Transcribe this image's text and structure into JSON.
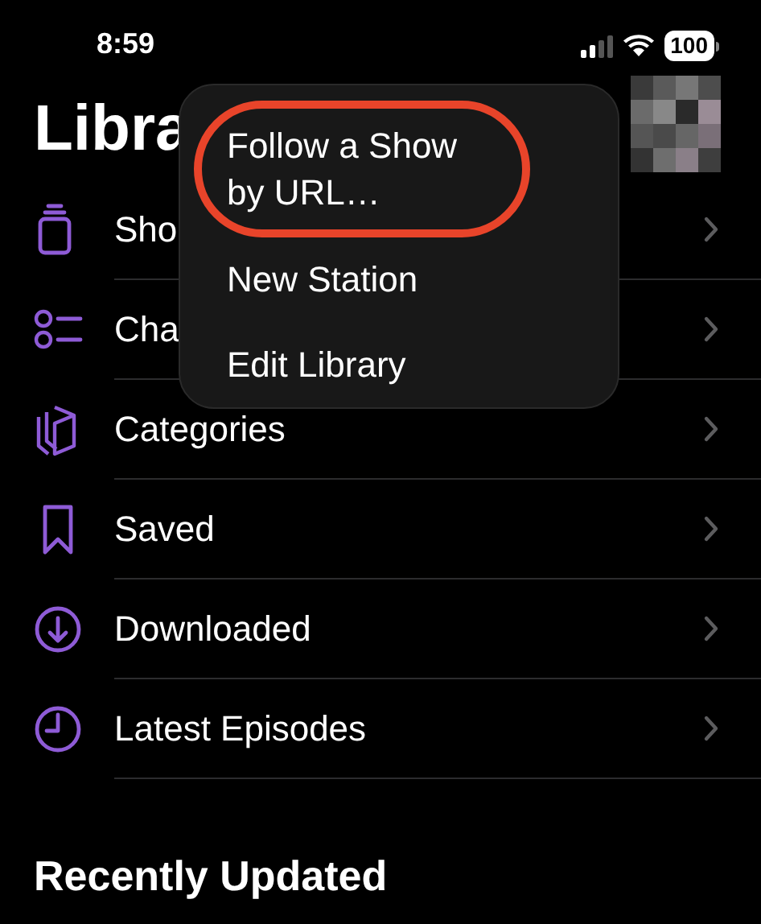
{
  "status_bar": {
    "time": "8:59",
    "battery": "100"
  },
  "title": "Libra",
  "items": [
    {
      "label": "Sho",
      "kind": "shows"
    },
    {
      "label": "Cha",
      "kind": "channels"
    },
    {
      "label": "Categories",
      "kind": "categories"
    },
    {
      "label": "Saved",
      "kind": "saved"
    },
    {
      "label": "Downloaded",
      "kind": "downloaded"
    },
    {
      "label": "Latest Episodes",
      "kind": "latest"
    }
  ],
  "menu": {
    "items": [
      {
        "label": "Follow a Show by URL…",
        "highlighted": true
      },
      {
        "label": "New Station",
        "highlighted": false
      },
      {
        "label": "Edit Library",
        "highlighted": false
      }
    ]
  },
  "section_title": "Recently Updated"
}
